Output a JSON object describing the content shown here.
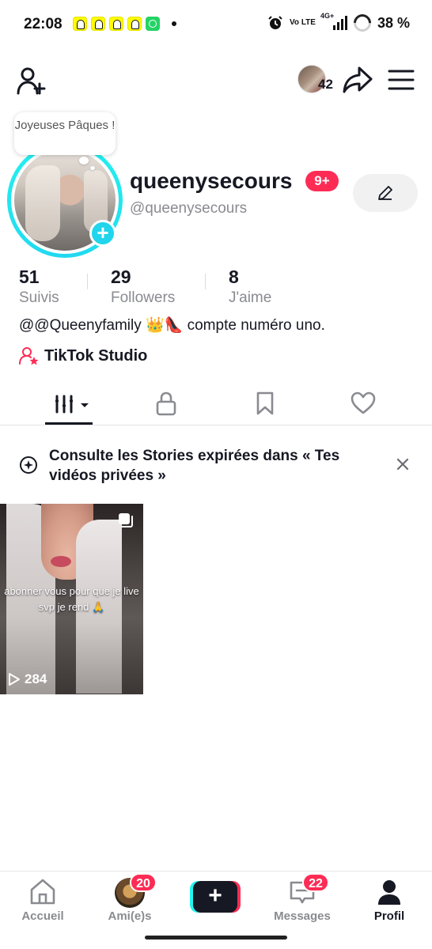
{
  "status_bar": {
    "time": "22:08",
    "network": "Vo LTE",
    "signal_type": "4G+",
    "battery": "38 %",
    "notification_icons": [
      "snapchat-icon",
      "snapchat-icon",
      "snapchat-icon",
      "snapchat-icon",
      "whatsapp-icon"
    ]
  },
  "top_nav": {
    "avatar_count": "42"
  },
  "profile": {
    "bubble_text": "Joyeuses Pâques !",
    "username": "queenysecours",
    "notif_badge": "9+",
    "handle": "@queenysecours",
    "stats": [
      {
        "value": "51",
        "label": "Suivis"
      },
      {
        "value": "29",
        "label": "Followers"
      },
      {
        "value": "8",
        "label": "J'aime"
      }
    ],
    "bio": "@@Queenyfamily 👑👠 compte numéro uno.",
    "studio_label": "TikTok Studio"
  },
  "tabs": [
    "videos-tab",
    "private-tab",
    "saved-tab",
    "liked-tab"
  ],
  "banner": {
    "text": "Consulte les Stories expirées dans « Tes vidéos privées »"
  },
  "videos": [
    {
      "caption": "abonner vous pour que je live svp je rend 🙏",
      "views": "284"
    }
  ],
  "bottom_nav": {
    "items": [
      {
        "label": "Accueil",
        "active": false
      },
      {
        "label": "Ami(e)s",
        "badge": "20",
        "active": false
      },
      {
        "label": "",
        "active": false
      },
      {
        "label": "Messages",
        "badge": "22",
        "active": false
      },
      {
        "label": "Profil",
        "active": true
      }
    ]
  },
  "colors": {
    "accent_pink": "#FE2C55",
    "accent_cyan": "#25F4EE",
    "text_primary": "#161823",
    "text_secondary": "#8A8B91"
  }
}
